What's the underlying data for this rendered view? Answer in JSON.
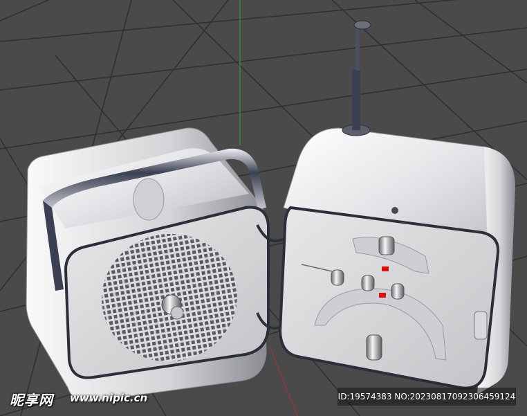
{
  "scene": {
    "subject": "radio-cube-3d-render",
    "colors": {
      "floor": "#4a4a4a",
      "grid": "#2f2f2f",
      "axis_green": "#2fa82f",
      "axis_red": "#b03030",
      "chrome_light": "#f4f4f6",
      "chrome_dark": "#2b2f3a",
      "face": "#d9d9dc",
      "indicator": "#e01010"
    }
  },
  "watermark": {
    "logo": "昵享网",
    "url": "www.nipic.cn",
    "id_text": "ID:19574383 NO:20230817092306459124"
  }
}
